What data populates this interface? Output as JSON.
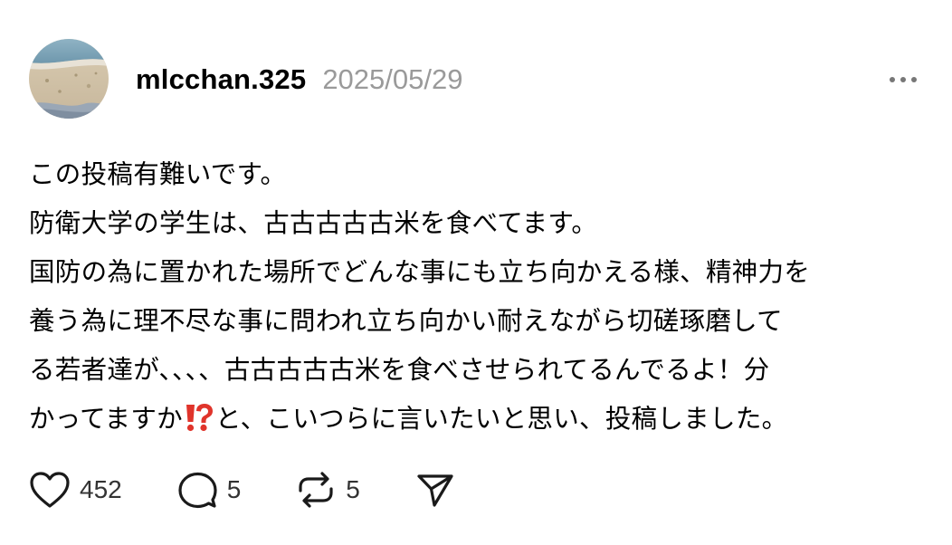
{
  "post": {
    "username": "mlcchan.325",
    "timestamp": "2025/05/29",
    "avatar_icon": "beach-photo-avatar",
    "more_icon": "more-dots-icon",
    "body_lines": [
      "この投稿有難いです。",
      "防衛大学の学生は、古古古古古米を食べてます。",
      "国防の為に置かれた場所でどんな事にも立ち向かえる様、精神力を",
      "養う為に理不尽な事に問われ立ち向かい耐えながら切磋琢磨して",
      "る若者達が、、、、古古古古古米を食べさせられてるんでるよ！分",
      "かってますか",
      "と、こいつらに言いたいと思い、投稿しました。"
    ],
    "emoji": "⁉️"
  },
  "actions": {
    "like_count": "452",
    "reply_count": "5",
    "repost_count": "5",
    "like_icon": "heart-icon",
    "reply_icon": "comment-bubble-icon",
    "repost_icon": "repost-icon",
    "share_icon": "send-icon"
  }
}
